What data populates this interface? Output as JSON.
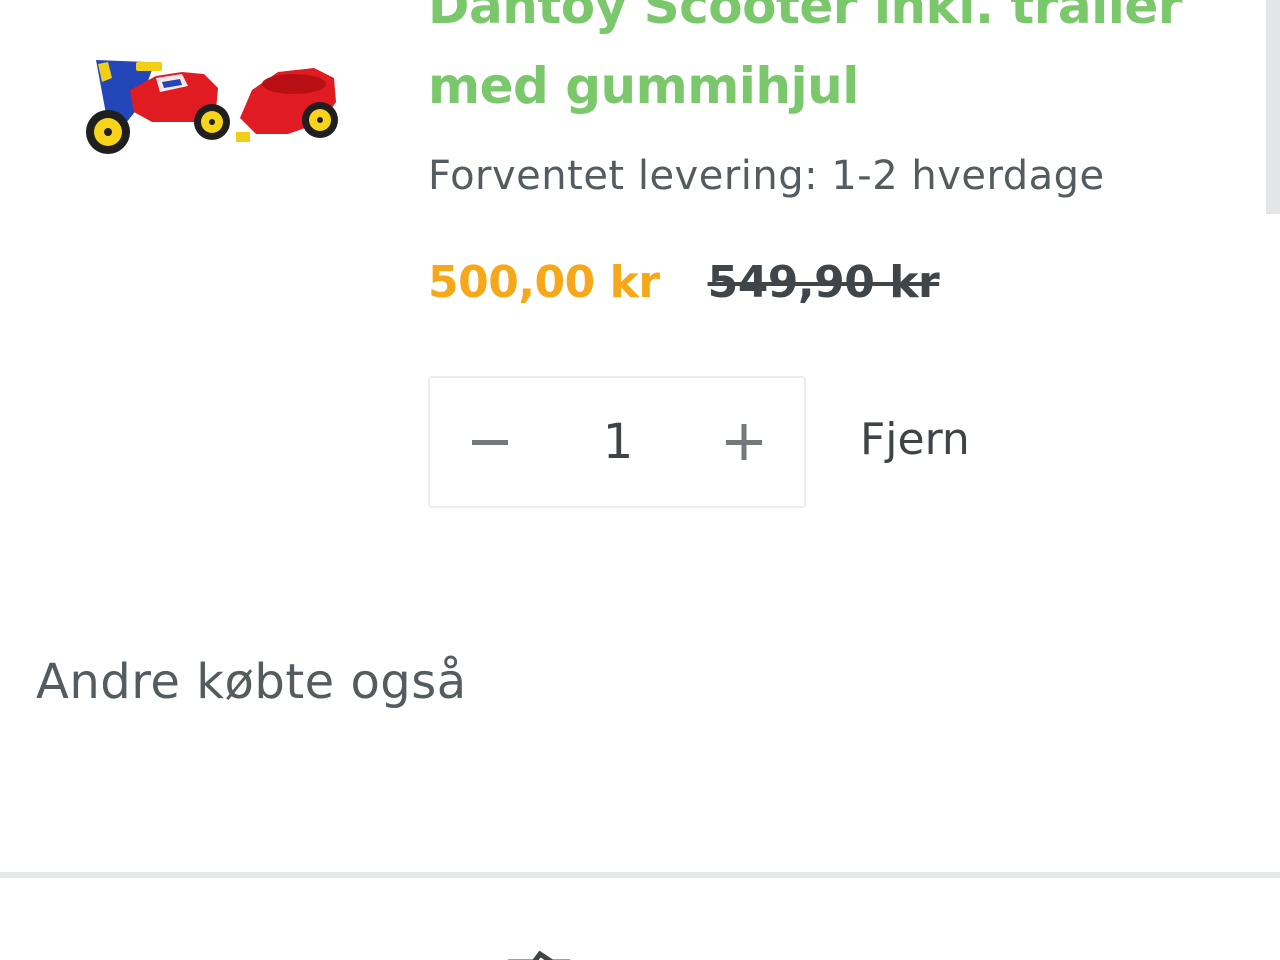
{
  "cart_item": {
    "title": "Dantoy Scooter inkl. trailer med gummihjul",
    "delivery": "Forventet levering: 1-2 hverdage",
    "price_sale": "500,00 kr",
    "price_old": "549,90 kr",
    "quantity": "1",
    "remove_label": "Fjern",
    "image_icon": "scooter-with-trailer-icon"
  },
  "section": {
    "heading": "Andre købte også"
  },
  "colors": {
    "title_green": "#7bc86c",
    "price_orange": "#f4a81a",
    "text_dark": "#3e4447",
    "text_gray": "#555c60"
  },
  "icons": {
    "decrease": "minus-icon",
    "increase": "plus-icon",
    "bottom_nav": "home-icon"
  }
}
